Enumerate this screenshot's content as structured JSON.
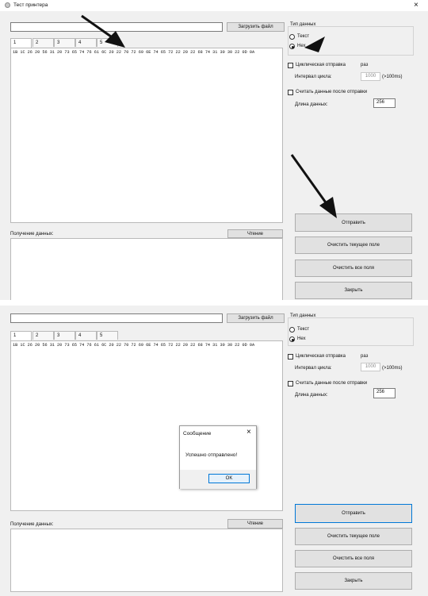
{
  "window": {
    "title": "Тест принтера",
    "close_glyph": "×"
  },
  "toolbar": {
    "file_path_value": "",
    "load_file_button": "Загрузить файл"
  },
  "tabs": [
    "1",
    "2",
    "3",
    "4",
    "5"
  ],
  "editor": {
    "content": "1B 1C 26 20 56 31 20 73  65 74 76 61 6C 20 22 70  72 69 6E 74 65 72 22 20  22 68 74 31 30 30 22 0D 0A"
  },
  "data_type": {
    "group_label": "Тип данных",
    "text_option": "Текст",
    "hex_option": "Hex",
    "selected": "Hex"
  },
  "cyclic": {
    "label": "Циклическая отправка",
    "unit": "раз",
    "interval_label": "Интервал цикла:",
    "interval_value": "1000",
    "interval_unit": "(>100ms)"
  },
  "read_after": {
    "label": "Считать данные после отправки",
    "length_label": "Длина данных:",
    "length_value": "256"
  },
  "receive": {
    "label": "Получение данных:",
    "read_button": "Чтение"
  },
  "buttons": {
    "send": "Отправить",
    "clear_current": "Очистить текущее поле",
    "clear_all": "Очистить все поля",
    "close": "Закрыть"
  },
  "message_dialog": {
    "title": "Сообщение",
    "close_glyph": "×",
    "text": "Успешно отправлено!",
    "ok": "OK"
  },
  "colors": {
    "annotation_arrow": "#111111",
    "accent_border": "#0078d7"
  }
}
